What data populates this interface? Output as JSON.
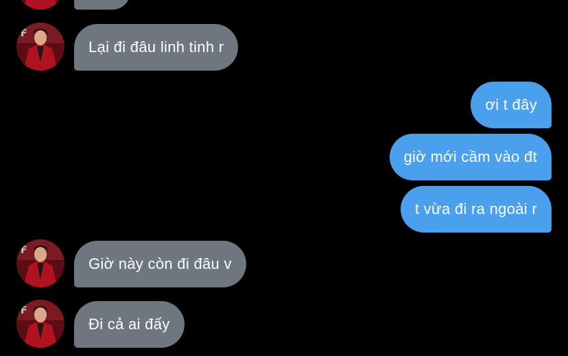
{
  "thread": {
    "messages": [
      {
        "sender": "contact",
        "text": "Lại đi đâu linh tinh r"
      },
      {
        "sender": "me",
        "text": "ơi t đây"
      },
      {
        "sender": "me",
        "text": "giờ mới cầm vào đt"
      },
      {
        "sender": "me",
        "text": "t vừa đi ra ngoài r"
      },
      {
        "sender": "contact",
        "text": "Giờ này còn đi đâu v"
      },
      {
        "sender": "contact",
        "text": "Đi cả ai đấy"
      }
    ]
  },
  "colors": {
    "background": "#000000",
    "incoming_bubble": "#6e7780",
    "outgoing_bubble": "#4aa0ec",
    "text": "#ffffff"
  },
  "icons": {
    "avatar": "contact-avatar-photo"
  }
}
